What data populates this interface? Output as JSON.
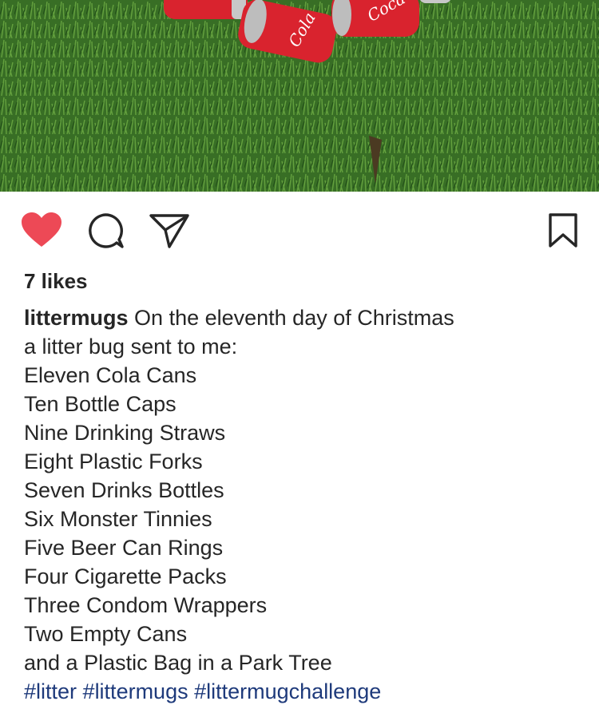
{
  "post": {
    "image_alt_subject": "Cola cans in grass",
    "can_brand_text": [
      "Coca",
      "Coca",
      "Cola"
    ],
    "liked": true,
    "likes_text": "7 likes",
    "username": "littermugs",
    "caption_first_line": "On the eleventh day of Christmas",
    "caption_lines": [
      "a litter bug sent to me:",
      "Eleven Cola Cans",
      "Ten Bottle Caps",
      "Nine Drinking Straws",
      "Eight Plastic Forks",
      "Seven Drinks Bottles",
      "Six Monster Tinnies",
      "Five Beer Can Rings",
      "Four Cigarette Packs",
      "Three Condom Wrappers",
      "Two Empty Cans",
      "and a Plastic Bag in a Park Tree"
    ],
    "hashtags": [
      "#litter",
      "#littermugs",
      "#littermugchallenge"
    ]
  },
  "icons": {
    "like": "heart-icon",
    "comment": "comment-icon",
    "share": "paper-plane-icon",
    "save": "bookmark-icon"
  },
  "colors": {
    "heart": "#ed4956",
    "hashtag": "#1e3a7b",
    "text": "#262626",
    "can_red": "#d9232e",
    "grass": "#3f7a2a"
  }
}
